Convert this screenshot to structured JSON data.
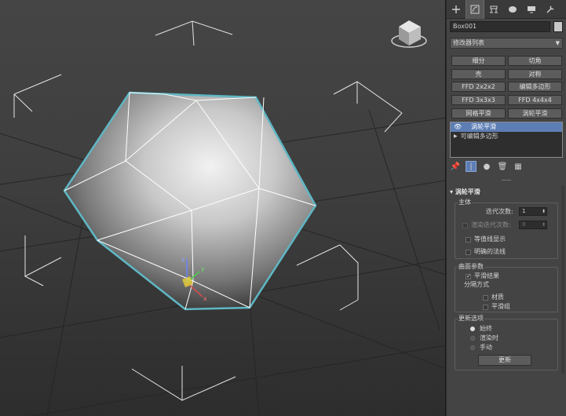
{
  "viewport": {
    "name": "perspective-viewport",
    "mesh_outline_color": "#5fb7c4",
    "wire_color": "#ffffff"
  },
  "panel": {
    "tabs": [
      {
        "icon": "plus-icon",
        "label": "create"
      },
      {
        "icon": "modify-icon",
        "label": "modify"
      },
      {
        "icon": "hierarchy-icon",
        "label": "hierarchy"
      },
      {
        "icon": "motion-icon",
        "label": "motion"
      },
      {
        "icon": "display-icon",
        "label": "display"
      },
      {
        "icon": "wrench-icon",
        "label": "utilities"
      }
    ],
    "object_name": "Box001",
    "object_color": "#c9c9c9",
    "modifier_list": "修改器列表",
    "modifier_buttons": [
      [
        "细分",
        "切角"
      ],
      [
        "壳",
        "对称"
      ],
      [
        "FFD 2x2x2",
        "编辑多边形"
      ],
      [
        "FFD 3x3x3",
        "FFD 4x4x4"
      ],
      [
        "网格平滑",
        "涡轮平滑"
      ]
    ],
    "stack": [
      {
        "label": "涡轮平滑",
        "selected": true
      },
      {
        "label": "可编辑多边形",
        "selected": false
      }
    ],
    "rollout": {
      "title": "涡轮平滑",
      "main_group": "主体",
      "iterations_label": "迭代次数:",
      "iterations_value": "1",
      "render_iters_label": "渲染迭代次数:",
      "render_iters_value": "0",
      "isoline_label": "等值线显示",
      "explicit_normals_label": "明确的法线",
      "surface_group": "曲面参数",
      "smooth_result_label": "平滑结果",
      "separate_by_label": "分隔方式",
      "materials_label": "材质",
      "smoothing_groups_label": "平滑组",
      "update_group": "更新选项",
      "always_label": "始终",
      "when_rendering_label": "渲染时",
      "manually_label": "手动",
      "update_button": "更新"
    }
  }
}
